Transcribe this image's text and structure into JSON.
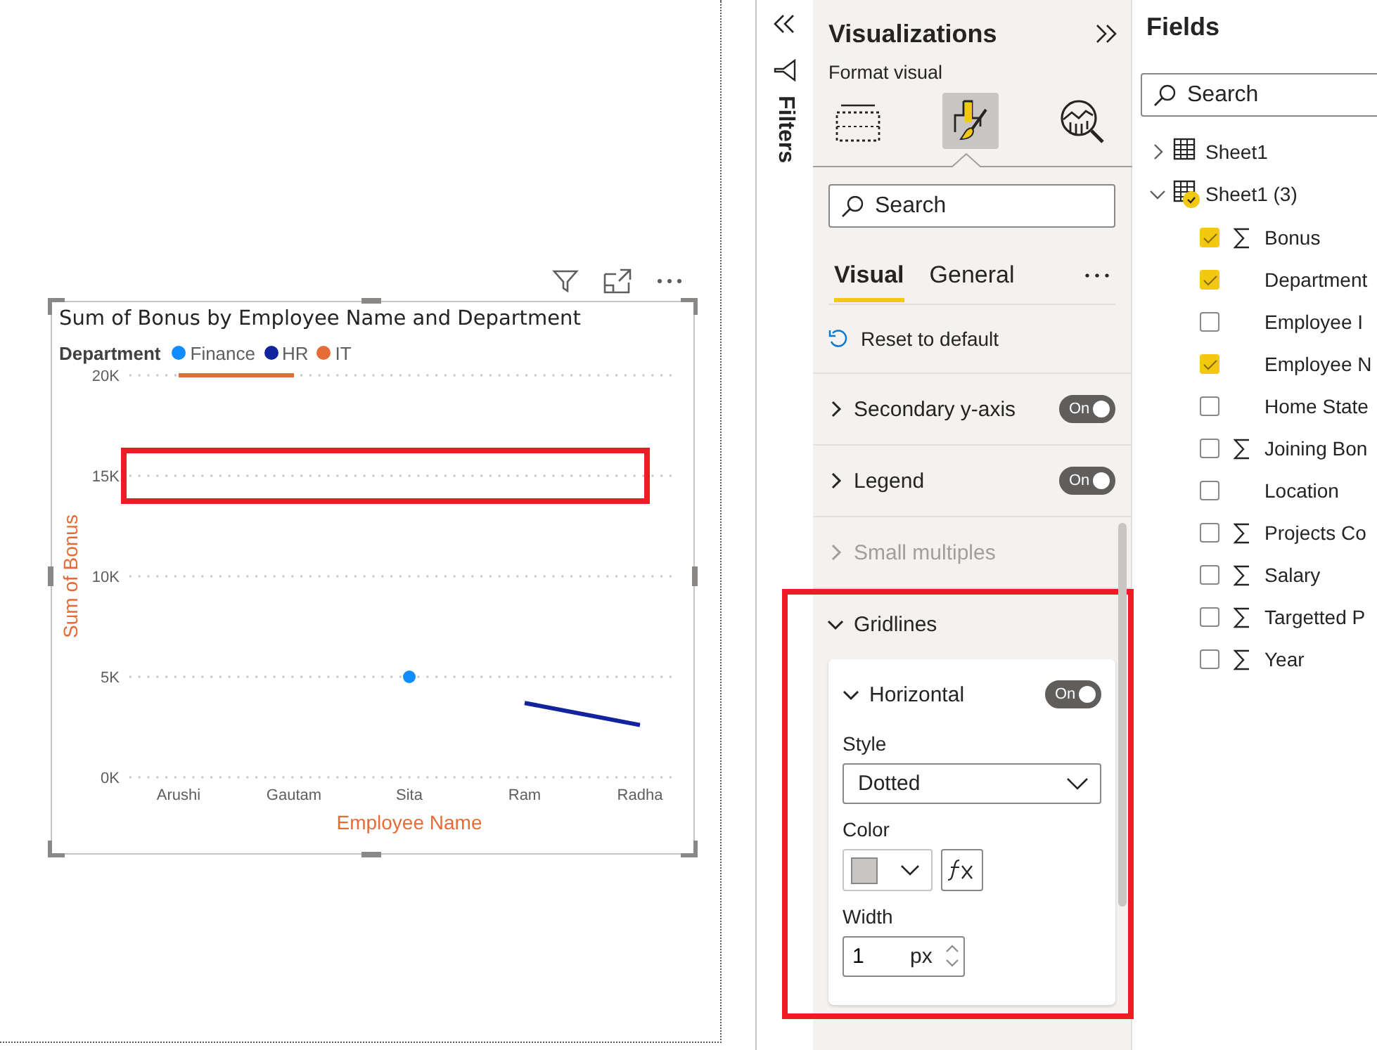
{
  "report_canvas": {
    "visual": {
      "highlight_box": true,
      "chart_data": {
        "type": "line",
        "legend": {
          "title": "Department"
        },
        "title": "Sum of Bonus by Employee Name and Department",
        "xlabel": "Employee Name",
        "ylabel": "Sum of Bonus",
        "categories": [
          "Arushi",
          "Gautam",
          "Sita",
          "Ram",
          "Radha"
        ],
        "series": [
          {
            "name": "Finance",
            "color": "#118dff",
            "marker": true,
            "values": [
              null,
              null,
              5000,
              null,
              null
            ]
          },
          {
            "name": "HR",
            "color": "#12239e",
            "marker": false,
            "values": [
              null,
              null,
              null,
              3700,
              2600
            ]
          },
          {
            "name": "IT",
            "color": "#e66c37",
            "marker": false,
            "values": [
              20000,
              20000,
              null,
              null,
              null
            ]
          }
        ],
        "ylim": [
          0,
          20000
        ],
        "grid": true,
        "yticks": [
          {
            "value": 0,
            "label": "0K"
          },
          {
            "value": 5000,
            "label": "5K"
          },
          {
            "value": 10000,
            "label": "10K"
          },
          {
            "value": 15000,
            "label": "15K"
          },
          {
            "value": 20000,
            "label": "20K"
          }
        ]
      }
    }
  },
  "filters_pane": {
    "label": "Filters"
  },
  "visualizations_pane": {
    "title": "Visualizations",
    "subtitle": "Format visual",
    "view_buttons": [
      {
        "kind": "build",
        "selected": false
      },
      {
        "kind": "format",
        "selected": true
      },
      {
        "kind": "analytics",
        "selected": false
      }
    ],
    "search": {
      "placeholder": "Search"
    },
    "tabs": [
      {
        "label": "Visual",
        "selected": true
      },
      {
        "label": "General",
        "selected": false
      }
    ],
    "reset_label": "Reset to default",
    "sections": [
      {
        "label": "Secondary y-axis",
        "expanded": false,
        "disabled": false,
        "highlighted": false,
        "toggle": {
          "on": true,
          "label": "On"
        }
      },
      {
        "label": "Legend",
        "expanded": false,
        "disabled": false,
        "highlighted": false,
        "toggle": {
          "on": true,
          "label": "On"
        }
      },
      {
        "label": "Small multiples",
        "expanded": false,
        "disabled": true,
        "highlighted": false
      },
      {
        "label": "Gridlines",
        "expanded": true,
        "disabled": false,
        "highlighted": true,
        "subsections": [
          {
            "label": "Horizontal",
            "expanded": true,
            "toggle": {
              "on": true,
              "label": "On"
            },
            "style": {
              "label": "Style",
              "value": "Dotted"
            },
            "color": {
              "label": "Color"
            },
            "width": {
              "label": "Width",
              "value": "1",
              "unit": "px"
            }
          }
        ]
      }
    ]
  },
  "fields_pane": {
    "title": "Fields",
    "search": {
      "placeholder": "Search"
    },
    "tables": [
      {
        "label": "Sheet1",
        "expanded": false,
        "has_selection": false
      },
      {
        "label": "Sheet1 (3)",
        "expanded": true,
        "has_selection": true,
        "children": [
          {
            "label": "Bonus",
            "aggregate": true,
            "checked": true
          },
          {
            "label": "Department",
            "aggregate": false,
            "checked": true
          },
          {
            "label": "Employee I",
            "aggregate": false,
            "checked": false
          },
          {
            "label": "Employee N",
            "aggregate": false,
            "checked": true
          },
          {
            "label": "Home State",
            "aggregate": false,
            "checked": false
          },
          {
            "label": "Joining Bon",
            "aggregate": true,
            "checked": false
          },
          {
            "label": "Location",
            "aggregate": false,
            "checked": false
          },
          {
            "label": "Projects Co",
            "aggregate": true,
            "checked": false
          },
          {
            "label": "Salary",
            "aggregate": true,
            "checked": false
          },
          {
            "label": "Targetted P",
            "aggregate": true,
            "checked": false
          },
          {
            "label": "Year",
            "aggregate": true,
            "checked": false
          }
        ]
      }
    ]
  }
}
